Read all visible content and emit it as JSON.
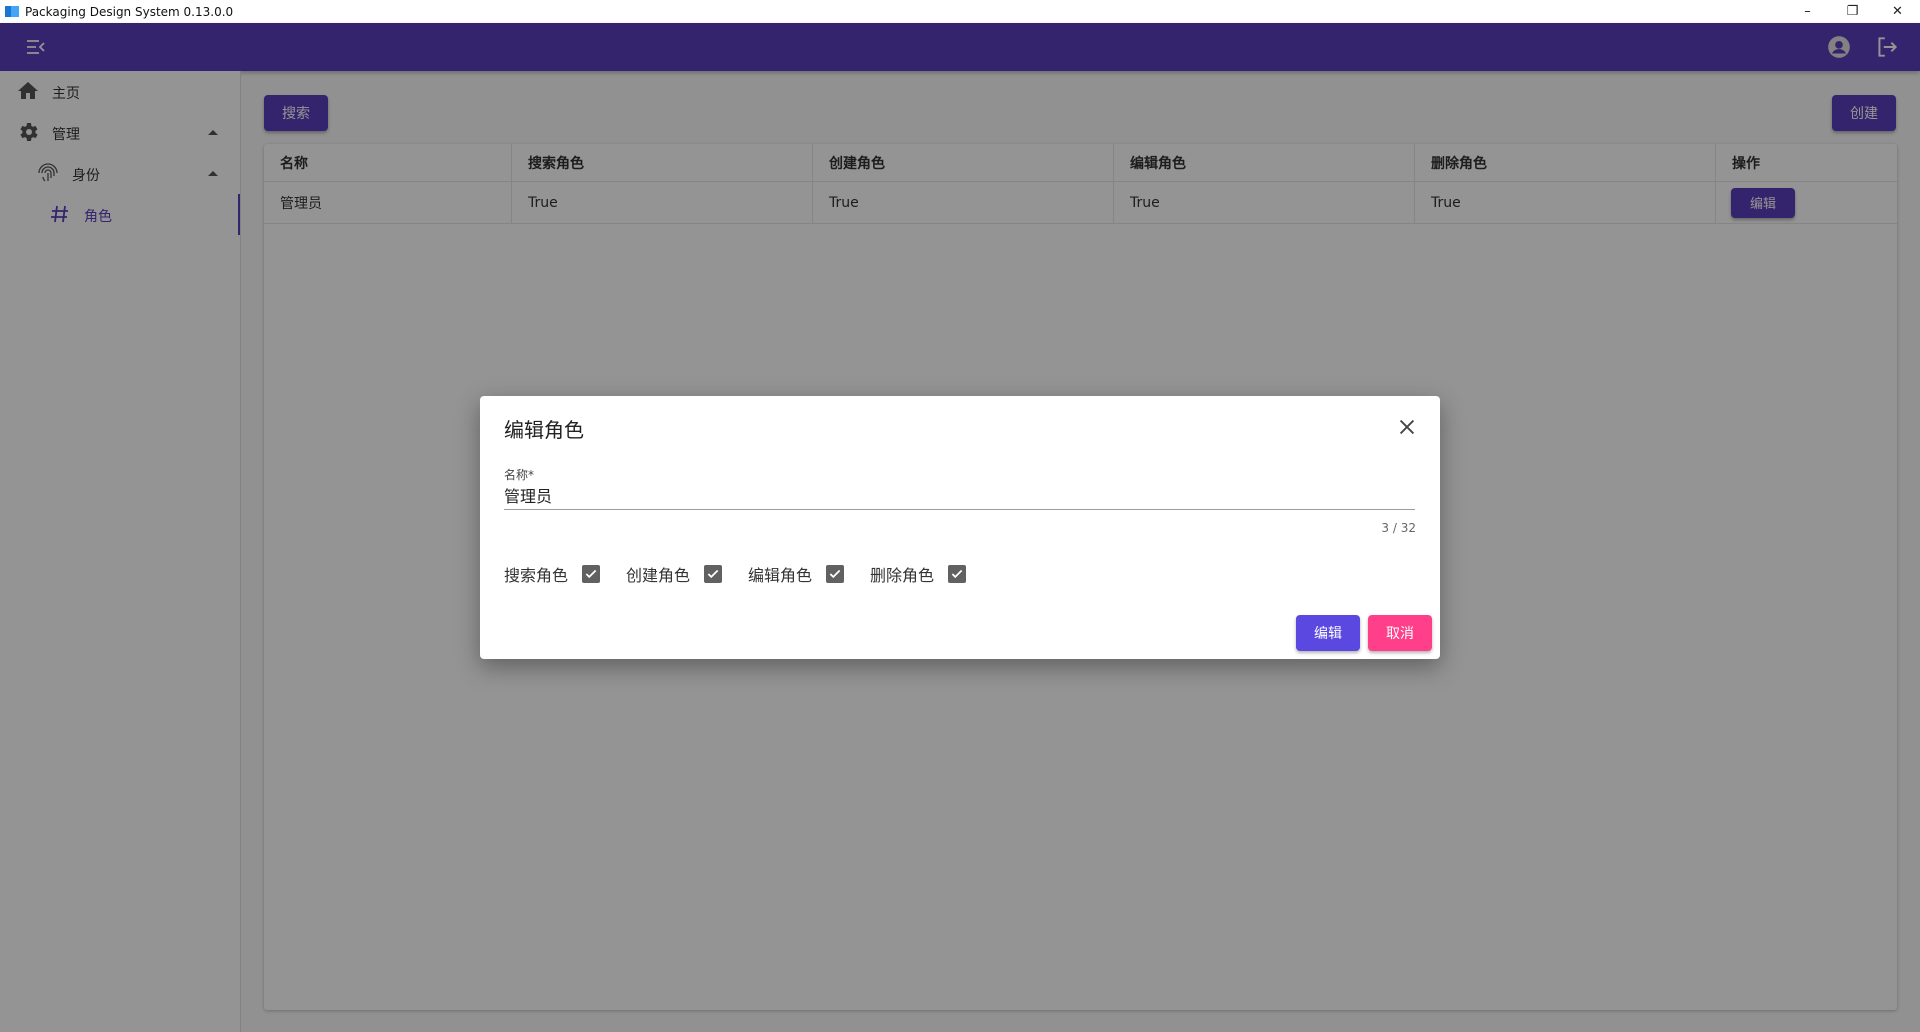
{
  "window": {
    "title": "Packaging Design System 0.13.0.0",
    "minimize_glyph": "–",
    "restore_glyph": "❐",
    "close_glyph": "✕"
  },
  "colors": {
    "primary": "#5a3fbe",
    "dialog_confirm": "#5a48e0",
    "dialog_cancel": "#ff3f8a",
    "checkbox": "#616161"
  },
  "appbar": {
    "menu_icon": "menu-collapse-icon",
    "account_icon": "account-circle-icon",
    "logout_icon": "logout-icon"
  },
  "sidebar": {
    "items": [
      {
        "label": "主页",
        "icon": "home-icon"
      },
      {
        "label": "管理",
        "icon": "gear-icon"
      },
      {
        "label": "身份",
        "icon": "fingerprint-icon"
      },
      {
        "label": "角色",
        "icon": "hash-icon"
      }
    ]
  },
  "toolbar": {
    "search_label": "搜索",
    "create_label": "创建"
  },
  "table": {
    "headers": [
      "名称",
      "搜索角色",
      "创建角色",
      "编辑角色",
      "删除角色",
      "操作"
    ],
    "rows": [
      {
        "name": "管理员",
        "search": "True",
        "create": "True",
        "edit": "True",
        "delete": "True",
        "action_label": "编辑"
      }
    ]
  },
  "dialog": {
    "title": "编辑角色",
    "name_label": "名称*",
    "name_value": "管理员",
    "counter": "3 / 32",
    "checks": [
      {
        "label": "搜索角色",
        "checked": true
      },
      {
        "label": "创建角色",
        "checked": true
      },
      {
        "label": "编辑角色",
        "checked": true
      },
      {
        "label": "删除角色",
        "checked": true
      }
    ],
    "confirm_label": "编辑",
    "cancel_label": "取消"
  }
}
